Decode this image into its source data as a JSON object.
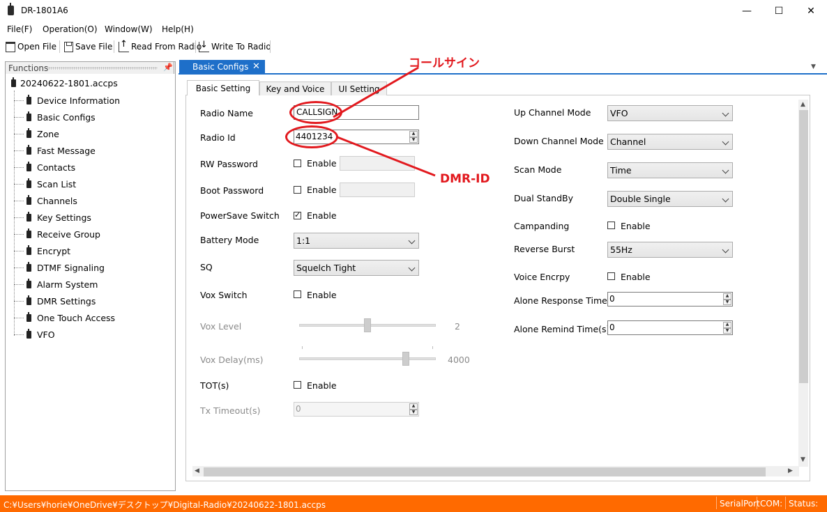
{
  "window": {
    "title": "DR-1801A6",
    "controls": {
      "minimize": "—",
      "maximize": "☐",
      "close": "✕"
    }
  },
  "menu": [
    "File(F)",
    "Operation(O)",
    "Window(W)",
    "Help(H)"
  ],
  "toolbar": {
    "open_file": "Open File",
    "save_file": "Save File",
    "read_from_radio": "Read From Radio",
    "write_to_radio": "Write To Radio"
  },
  "functions_panel": {
    "title": "Functions",
    "root": "20240622-1801.accps",
    "items": [
      "Device Information",
      "Basic Configs",
      "Zone",
      "Fast Message",
      "Contacts",
      "Scan List",
      "Channels",
      "Key Settings",
      "Receive Group",
      "Encrypt",
      "DTMF Signaling",
      "Alarm System",
      "DMR Settings",
      "One Touch Access",
      "VFO"
    ]
  },
  "document": {
    "tab_label": "Basic Configs",
    "subtabs": [
      "Basic Setting",
      "Key and Voice",
      "UI Setting"
    ]
  },
  "form_left": {
    "radio_name_label": "Radio Name",
    "radio_name_value": "CALLSIGN",
    "radio_id_label": "Radio Id",
    "radio_id_value": "4401234",
    "rw_password_label": "RW Password",
    "boot_password_label": "Boot Password",
    "enable_label": "Enable",
    "powersave_label": "PowerSave Switch",
    "battery_mode_label": "Battery Mode",
    "battery_mode_value": "1:1",
    "sq_label": "SQ",
    "sq_value": "Squelch Tight",
    "vox_switch_label": "Vox Switch",
    "vox_level_label": "Vox Level",
    "vox_level_value": "2",
    "vox_delay_label": "Vox Delay(ms)",
    "vox_delay_value": "4000",
    "tot_label": "TOT(s)",
    "tx_timeout_label": "Tx Timeout(s)",
    "tx_timeout_value": "0"
  },
  "form_right": {
    "up_channel_mode_label": "Up Channel Mode",
    "up_channel_mode_value": "VFO",
    "down_channel_mode_label": "Down Channel Mode",
    "down_channel_mode_value": "Channel",
    "scan_mode_label": "Scan Mode",
    "scan_mode_value": "Time",
    "dual_standby_label": "Dual StandBy",
    "dual_standby_value": "Double Single",
    "campanding_label": "Campanding",
    "reverse_burst_label": "Reverse Burst",
    "reverse_burst_value": "55Hz",
    "voice_encrpy_label": "Voice Encrpy",
    "alone_response_label": "Alone Response Time(r",
    "alone_response_value": "0",
    "alone_remind_label": "Alone Remind Time(s)",
    "alone_remind_value": "0"
  },
  "checkboxes": {
    "rw_password": false,
    "boot_password": false,
    "powersave": true,
    "vox_switch": false,
    "tot": false,
    "campanding": false,
    "voice_encrpy": false
  },
  "annotations": {
    "callsign_note": "コールサイン",
    "dmr_id_note": "DMR-ID",
    "color": "#e2191e"
  },
  "statusbar": {
    "path": "C:¥Users¥horie¥OneDrive¥デスクトップ¥Digital-Radio¥20240622-1801.accps",
    "serial_port": "SerialPort",
    "com": "COM:",
    "status": "Status:"
  },
  "colors": {
    "accent": "#1e6fc9",
    "statusbar": "#ff6a00"
  }
}
